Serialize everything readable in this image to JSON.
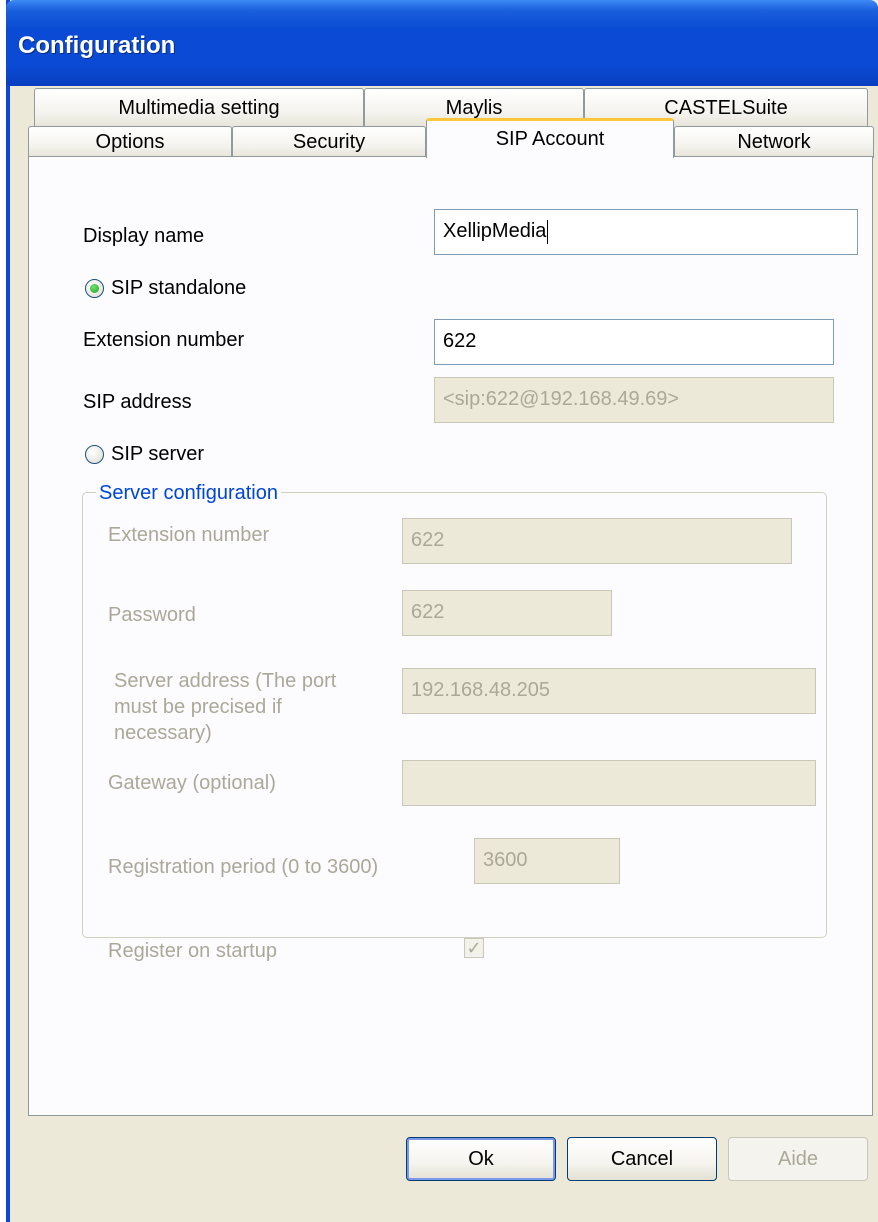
{
  "window": {
    "title": "Configuration"
  },
  "tabs": {
    "row_back": [
      {
        "label": "Multimedia setting"
      },
      {
        "label": "Maylis"
      },
      {
        "label": "CASTELSuite"
      }
    ],
    "row_front": [
      {
        "label": "Options"
      },
      {
        "label": "Security"
      },
      {
        "label": "SIP Account",
        "selected": true
      },
      {
        "label": "Network"
      }
    ]
  },
  "sip_account": {
    "display_name": {
      "label": "Display name",
      "value": "XellipMedia"
    },
    "standalone_radio": {
      "label": "SIP standalone",
      "selected": true
    },
    "extension_number": {
      "label": "Extension number",
      "value": "622"
    },
    "sip_address": {
      "label": "SIP address",
      "value": "<sip:622@192.168.49.69>"
    },
    "server_radio": {
      "label": "SIP server",
      "selected": false
    },
    "server_config": {
      "title": "Server configuration",
      "extension_number": {
        "label": "Extension number",
        "value": "622"
      },
      "password": {
        "label": "Password",
        "value": "622"
      },
      "server_address": {
        "label": "Server address (The port must be precised if necessary)",
        "value": "192.168.48.205"
      },
      "gateway": {
        "label": "Gateway (optional)",
        "value": ""
      },
      "registration_period": {
        "label": "Registration period (0 to 3600)",
        "value": "3600"
      },
      "register_on_startup": {
        "label": "Register on startup",
        "checked": true
      }
    }
  },
  "buttons": {
    "ok": "Ok",
    "cancel": "Cancel",
    "help": "Aide"
  },
  "colors": {
    "titlebar": "#0a4ad4",
    "dialog_bg": "#ece9d8",
    "active_tab_accent": "#ffc83c",
    "group_title": "#0046d5",
    "radio_dot": "#21a121",
    "disabled_text": "#aca899"
  },
  "icons": {
    "radio_selected": "radio-dot",
    "checkbox_checked": "check-mark"
  }
}
